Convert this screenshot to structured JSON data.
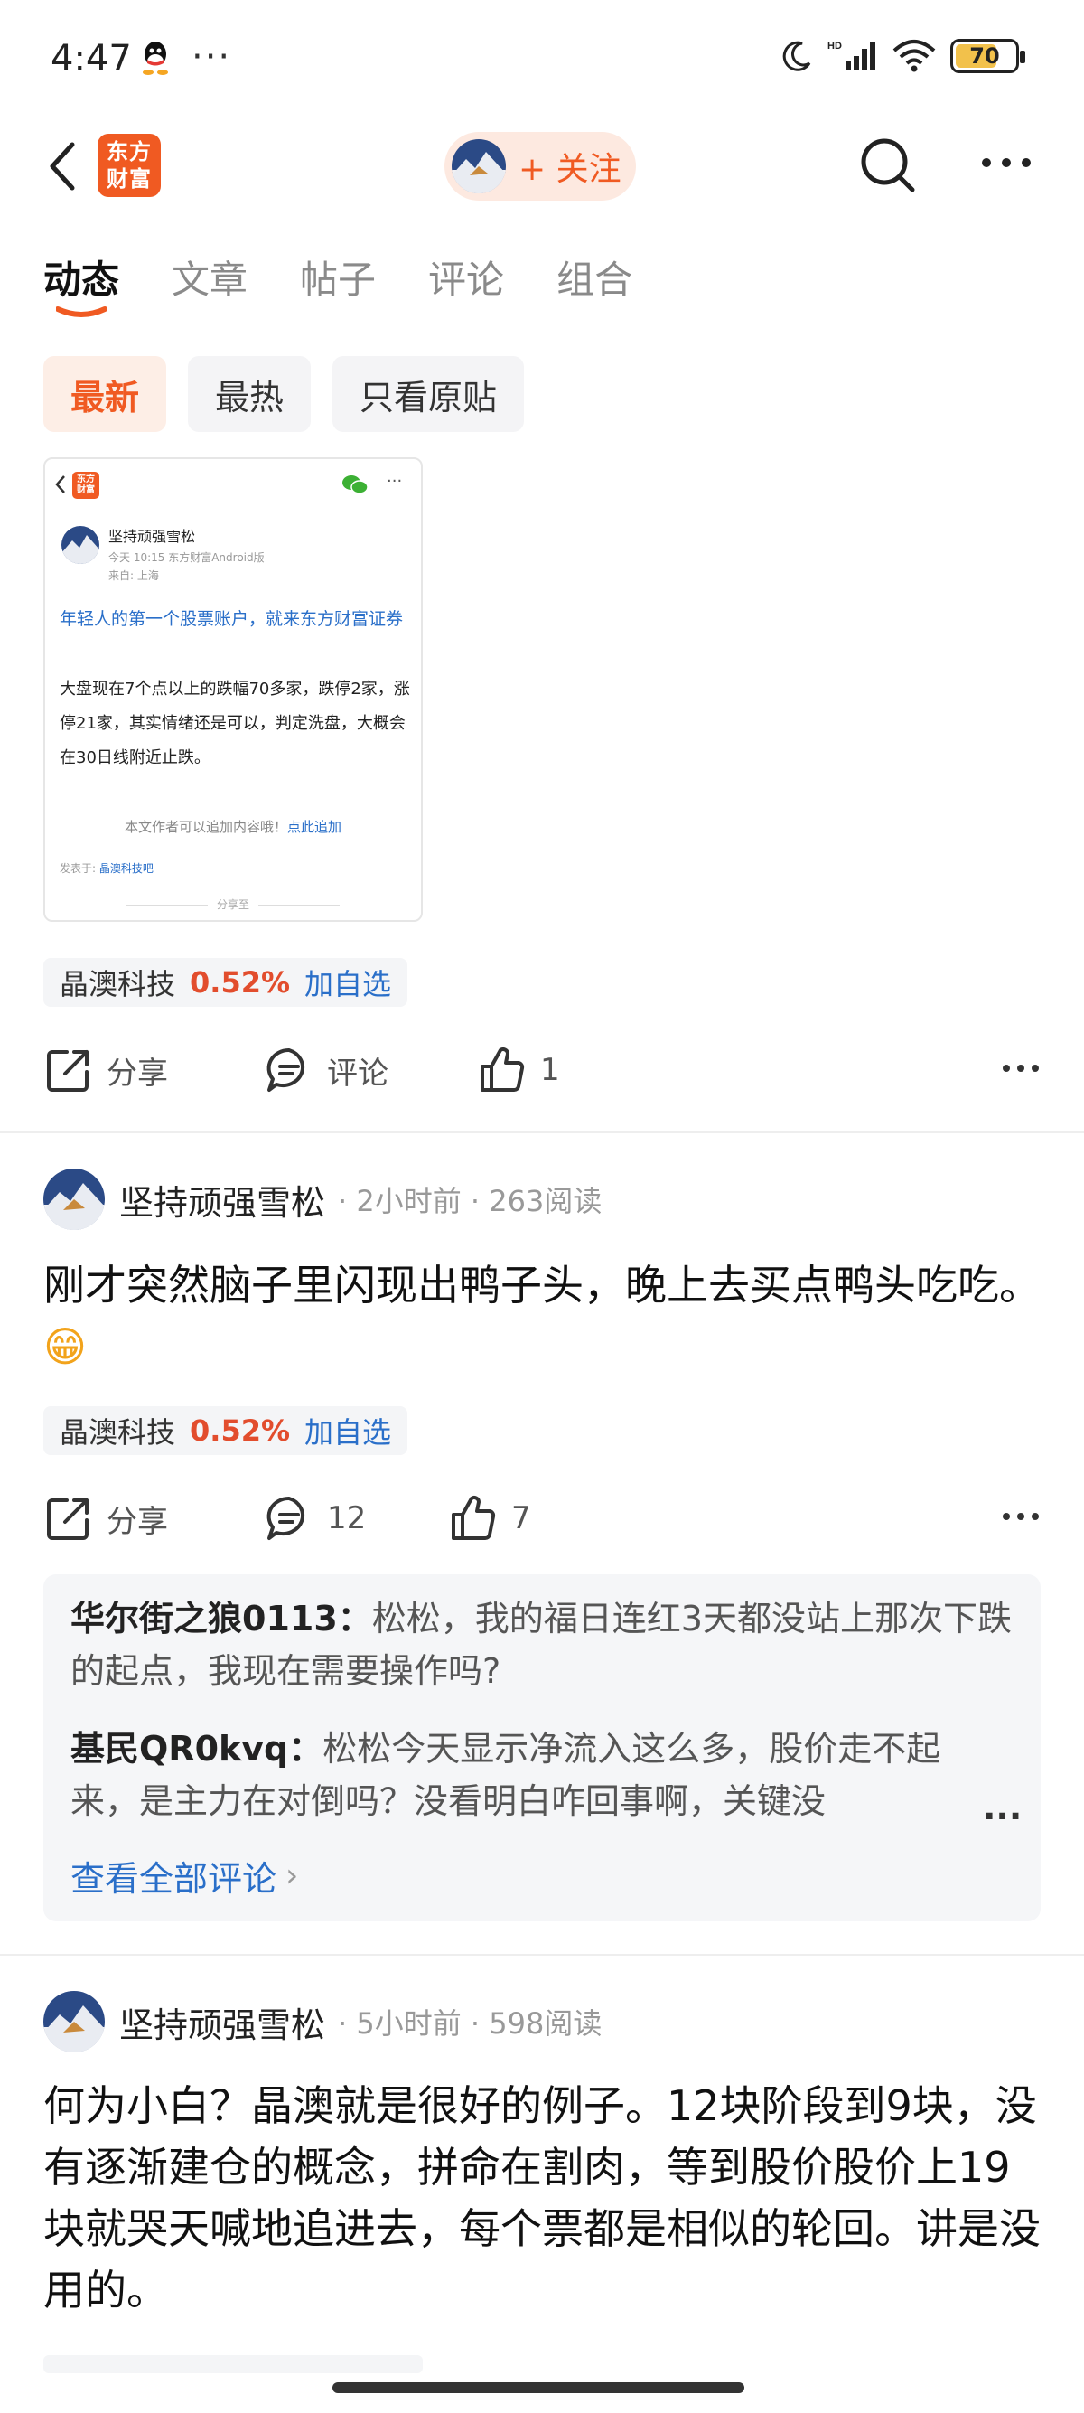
{
  "status_bar": {
    "time": "4:47",
    "dots": "···",
    "battery": "70"
  },
  "nav": {
    "logo_text": "东方\n财富",
    "follow_label": "+ 关注"
  },
  "tabs": [
    {
      "label": "动态",
      "active": true
    },
    {
      "label": "文章",
      "active": false
    },
    {
      "label": "帖子",
      "active": false
    },
    {
      "label": "评论",
      "active": false
    },
    {
      "label": "组合",
      "active": false
    }
  ],
  "filters": [
    {
      "label": "最新",
      "active": true
    },
    {
      "label": "最热",
      "active": false
    },
    {
      "label": "只看原贴",
      "active": false
    }
  ],
  "embedded_post": {
    "logo_text": "东方\n财富",
    "more": "···",
    "username": "坚持顽强雪松",
    "meta": "今天 10:15 东方财富Android版",
    "location": "来自: 上海",
    "ad_text": "年轻人的第一个股票账户，就来东方财富证券",
    "body": "大盘现在7个点以上的跌幅70多家，跌停2家，涨停21家，其实情绪还是可以，判定洗盘，大概会在30日线附近止跌。",
    "append_prefix": "本文作者可以追加内容哦！",
    "append_link": "点此追加",
    "posted_prefix": "发表于: ",
    "posted_link": "晶澳科技吧",
    "share_label": "分享至"
  },
  "stock_tag": {
    "name": "晶澳科技",
    "change": "0.52%",
    "add_label": "加自选"
  },
  "action_labels": {
    "share": "分享",
    "comment": "评论"
  },
  "post1_actions": {
    "likes": "1"
  },
  "post2": {
    "username": "坚持顽强雪松",
    "meta": "· 2小时前 · 263阅读",
    "text": "刚才突然脑子里闪现出鸭子头，晚上去买点鸭头吃吃。",
    "emoji": "😁",
    "comments_count": "12",
    "likes": "7"
  },
  "comment_preview": {
    "items": [
      {
        "author": "华尔街之狼0113：",
        "text": "松松，我的福日连红3天都没站上那次下跌的起点，我现在需要操作吗?"
      },
      {
        "author": "基民QR0kvq：",
        "text": "松松今天显示净流入这么多，股价走不起来，是主力在对倒吗？没看明白咋回事啊，关键没"
      }
    ],
    "ellipsis": "...",
    "view_all": "查看全部评论",
    "chevron": "›"
  },
  "post3": {
    "username": "坚持顽强雪松",
    "meta": "· 5小时前 · 598阅读",
    "text": "何为小白？晶澳就是很好的例子。12块阶段到9块，没有逐渐建仓的概念，拼命在割肉，等到股价股价上19块就哭天喊地追进去，每个票都是相似的轮回。讲是没用的。"
  },
  "colors": {
    "brand": "#f05a22",
    "rise": "#e24d2d",
    "link": "#2a6fc9"
  }
}
